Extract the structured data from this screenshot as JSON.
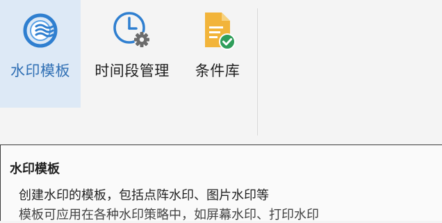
{
  "ribbon": {
    "tools": [
      {
        "label": "水印模板",
        "icon": "watermark-wave-icon",
        "active": true
      },
      {
        "label": "时间段管理",
        "icon": "clock-gear-icon",
        "active": false
      },
      {
        "label": "条件库",
        "icon": "document-check-icon",
        "active": false
      }
    ]
  },
  "tooltip": {
    "title": "水印模板",
    "description": "创建水印的模板，包括点阵水印、图片水印等",
    "description_cut": "模板可应用在各种水印策略中，如屏幕水印、打印水印"
  },
  "colors": {
    "active_bg": "#dde9f6",
    "active_text": "#2f6fb4",
    "accent_blue": "#2f7fd0",
    "gear_gray": "#6b6b6b",
    "doc_yellow": "#f2b43a",
    "check_green": "#2f9e5a"
  }
}
